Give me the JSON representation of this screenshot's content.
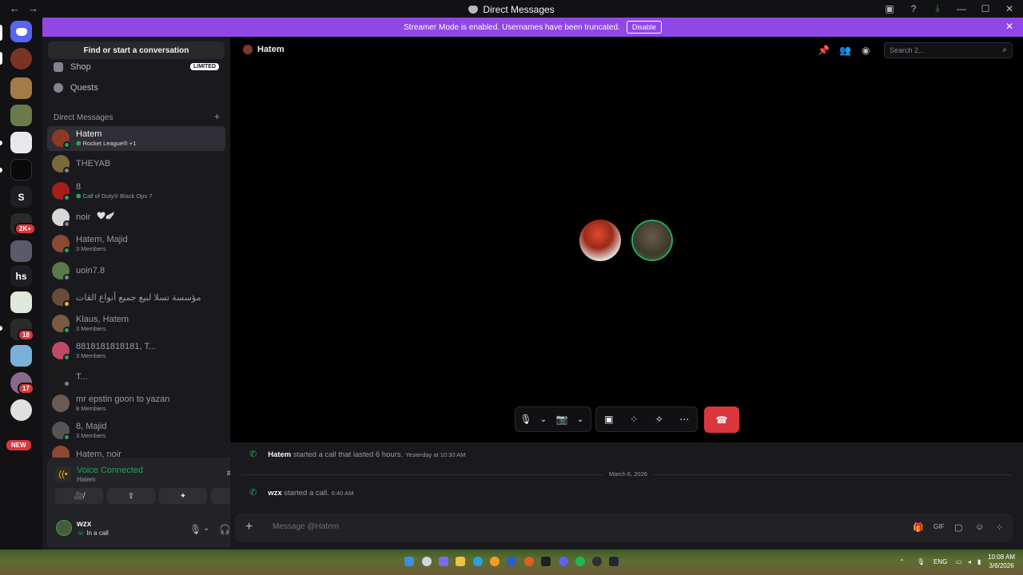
{
  "window": {
    "title": "Direct Messages",
    "nav_back": "←",
    "nav_forward": "→",
    "controls": [
      "▣",
      "?",
      "⤓",
      "—",
      "☐",
      "✕"
    ]
  },
  "banner": {
    "text": "Streamer Mode is enabled. Usernames have been truncated.",
    "button": "Disable",
    "close": "✕"
  },
  "servers": {
    "badges": [
      "2K+",
      "18",
      "17"
    ],
    "text_servers": [
      "S",
      "hs"
    ],
    "new_label": "NEW"
  },
  "sidebar": {
    "find_placeholder": "Find or start a conversation",
    "nav": [
      {
        "label": "Shop",
        "badge": "LIMITED"
      },
      {
        "label": "Quests"
      }
    ],
    "dm_header": "Direct Messages",
    "dm_add": "+",
    "dms": [
      {
        "name": "Hatem",
        "sub": "Rocket League® +1",
        "status": "#23a55a",
        "avatar": "#8a3a24",
        "game": true
      },
      {
        "name": "THEYAB",
        "sub": "",
        "status": "#80848e",
        "avatar": "#7a6a3a"
      },
      {
        "name": "8",
        "sub": "Call of Duty® Black Ops 7",
        "status": "#23a55a",
        "avatar": "#a51d1d",
        "game": true
      },
      {
        "name": "noir",
        "sub": "",
        "status": "#80848e",
        "avatar": "#d8d8d8",
        "emoji": "🤍🪽"
      },
      {
        "name": "Hatem, Majid",
        "sub": "3 Members",
        "status": "#23a55a",
        "avatar": "#8a4a34"
      },
      {
        "name": "uoin7.8",
        "sub": "",
        "status": "#80848e",
        "avatar": "#5a7a4a"
      },
      {
        "name": "مؤسسة تسلا لبيع جميع أنواع القات",
        "sub": "",
        "status": "#f0b232",
        "avatar": "#6a4a3a"
      },
      {
        "name": "Klaus, Hatem",
        "sub": "3 Members",
        "status": "#23a55a",
        "avatar": "#7a5a44"
      },
      {
        "name": "8818181818181, T...",
        "sub": "3 Members",
        "status": "#23a55a",
        "avatar": "#c04a6a"
      },
      {
        "name": "T...",
        "sub": "",
        "status": "#80848e",
        "avatar": "#1a1a1a"
      },
      {
        "name": "mr epstin goon to yazan",
        "sub": "8 Members",
        "status": "",
        "avatar": "#6a5a54"
      },
      {
        "name": "8, Majid",
        "sub": "3 Members",
        "status": "#23a55a",
        "avatar": "#555555"
      },
      {
        "name": "Hatem, noir",
        "sub": "",
        "status": "",
        "avatar": "#8a4a34"
      }
    ]
  },
  "voice": {
    "status": "Voice Connected",
    "channel": "Hatem",
    "buttons": [
      "🎥̸",
      "⇪",
      "✦",
      "♪"
    ]
  },
  "user": {
    "name": "wzx",
    "status": "In a call",
    "controls": [
      "🎙",
      "⌄",
      "🎧",
      "⌄",
      "⚙"
    ]
  },
  "main": {
    "header_name": "Hatem",
    "search_placeholder": "Search 2...",
    "messages": [
      {
        "user": "Hatem",
        "text": "started a call that lasted 6 hours.",
        "time": "Yesterday at 10:30 AM"
      },
      {
        "user": "wzx",
        "text": "started a call.",
        "time": "6:40 AM"
      }
    ],
    "date_divider": "March 6, 2026",
    "composer_placeholder": "Message @Hatem",
    "call_controls": {
      "group1": [
        "🎙",
        "⌄",
        "📷",
        "⌄"
      ],
      "group2": [
        "▣",
        "⁘",
        "✧",
        "⋯"
      ],
      "hangup": "☎"
    }
  },
  "taskbar": {
    "lang": "ENG",
    "time": "10:08 AM",
    "date": "3/6/2026"
  }
}
